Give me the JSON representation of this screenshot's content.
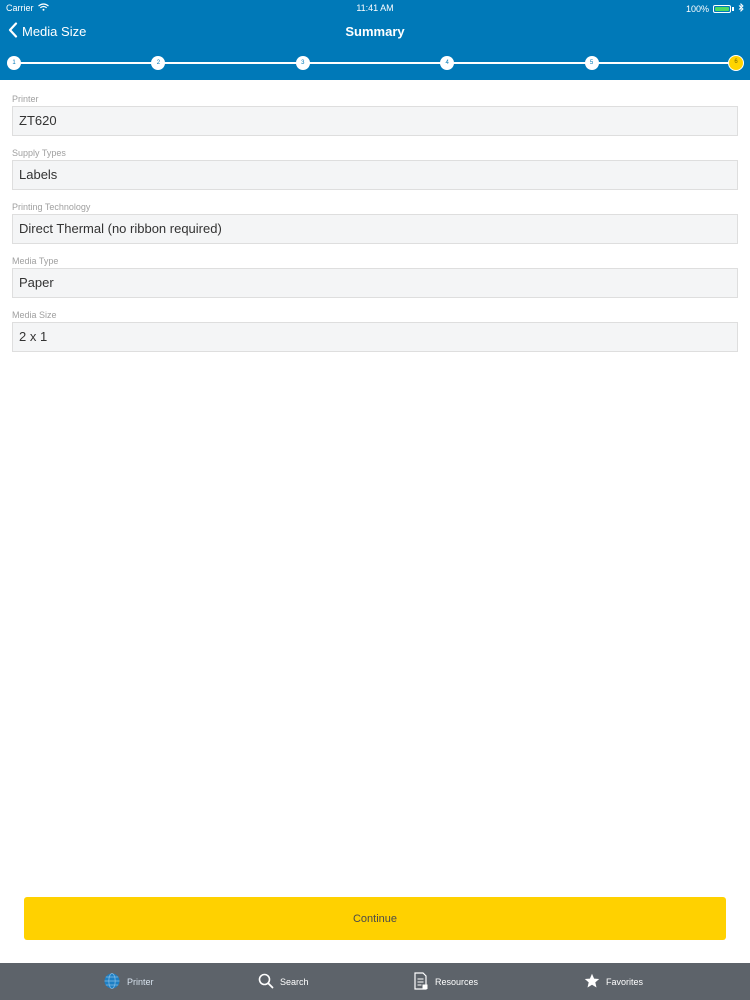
{
  "status_bar": {
    "carrier": "Carrier",
    "time": "11:41 AM",
    "battery": "100%"
  },
  "nav": {
    "back_label": "Media Size",
    "title": "Summary"
  },
  "stepper": {
    "steps": [
      "1",
      "2",
      "3",
      "4",
      "5",
      "6"
    ],
    "current_step": 6
  },
  "fields": [
    {
      "label": "Printer",
      "value": "ZT620"
    },
    {
      "label": "Supply Types",
      "value": "Labels"
    },
    {
      "label": "Printing Technology",
      "value": "Direct Thermal (no ribbon required)"
    },
    {
      "label": "Media Type",
      "value": "Paper"
    },
    {
      "label": "Media Size",
      "value": "2 x 1"
    }
  ],
  "continue_label": "Continue",
  "tabs": [
    {
      "label": "Printer",
      "icon": "globe-icon",
      "active": true
    },
    {
      "label": "Search",
      "icon": "search-icon",
      "active": false
    },
    {
      "label": "Resources",
      "icon": "document-icon",
      "active": false
    },
    {
      "label": "Favorites",
      "icon": "star-icon",
      "active": false
    }
  ],
  "colors": {
    "header": "#0079b8",
    "accent": "#ffd100",
    "tabbar": "#5d636a"
  }
}
